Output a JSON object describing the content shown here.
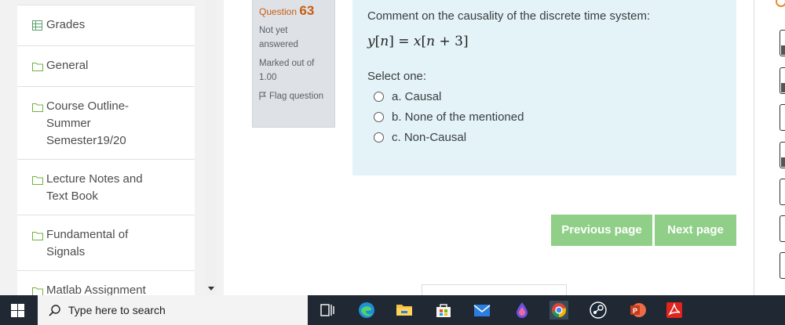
{
  "drawer": {
    "items": [
      {
        "label": "Grades",
        "icon": "table-icon"
      },
      {
        "label": "General",
        "icon": "folder-icon"
      },
      {
        "label": "Course Outline-\nSummer\nSemester19/20",
        "icon": "folder-icon"
      },
      {
        "label": "Lecture Notes and\nText Book",
        "icon": "folder-icon"
      },
      {
        "label": "Fundamental of\nSignals",
        "icon": "folder-icon"
      },
      {
        "label": "Matlab Assignment",
        "icon": "folder-icon"
      }
    ]
  },
  "question_info": {
    "question_prefix": "Question",
    "question_number": "63",
    "status": "Not yet answered",
    "marked_out_of": "Marked out of 1.00",
    "flag_label": "Flag question"
  },
  "question": {
    "text": "Comment on the causality of the discrete time system:",
    "select_one_label": "Select one:",
    "options": [
      {
        "label": "a. Causal"
      },
      {
        "label": "b. None of the mentioned"
      },
      {
        "label": "c. Non-Causal"
      }
    ]
  },
  "navigation": {
    "previous_label": "Previous page",
    "next_label": "Next page"
  },
  "taskbar": {
    "search_placeholder": "Type here to search"
  },
  "colors": {
    "question_number": "#c75d13",
    "question_bg": "#e3f3f7",
    "info_bg": "#dee2e6",
    "button_bg": "#8fcf88",
    "taskbar_bg": "#1f2833"
  }
}
